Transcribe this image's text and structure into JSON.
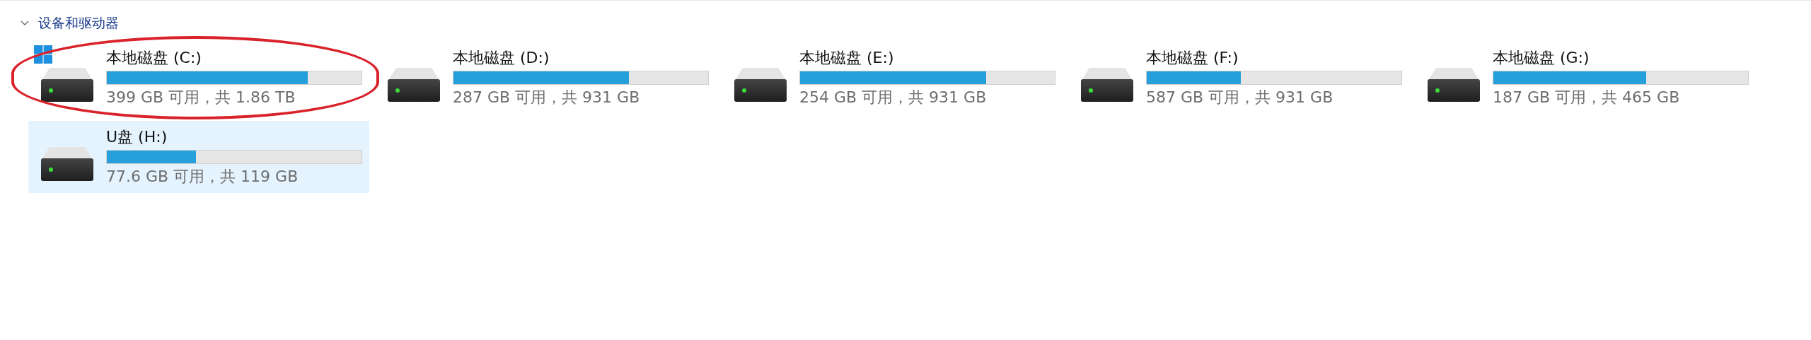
{
  "section": {
    "title": "设备和驱动器",
    "expanded": true
  },
  "drives": [
    {
      "name": "本地磁盘 (C:)",
      "info": "399 GB 可用，共 1.86 TB",
      "level": 0.79,
      "system": true,
      "selected": false,
      "circled": true
    },
    {
      "name": "本地磁盘 (D:)",
      "info": "287 GB 可用，共 931 GB",
      "level": 0.69,
      "system": false,
      "selected": false,
      "circled": false
    },
    {
      "name": "本地磁盘 (E:)",
      "info": "254 GB 可用，共 931 GB",
      "level": 0.73,
      "system": false,
      "selected": false,
      "circled": false
    },
    {
      "name": "本地磁盘 (F:)",
      "info": "587 GB 可用，共 931 GB",
      "level": 0.37,
      "system": false,
      "selected": false,
      "circled": false
    },
    {
      "name": "本地磁盘 (G:)",
      "info": "187 GB 可用，共 465 GB",
      "level": 0.6,
      "system": false,
      "selected": false,
      "circled": false
    },
    {
      "name": "U盘 (H:)",
      "info": "77.6 GB 可用，共 119 GB",
      "level": 0.35,
      "system": false,
      "selected": true,
      "circled": false
    }
  ]
}
